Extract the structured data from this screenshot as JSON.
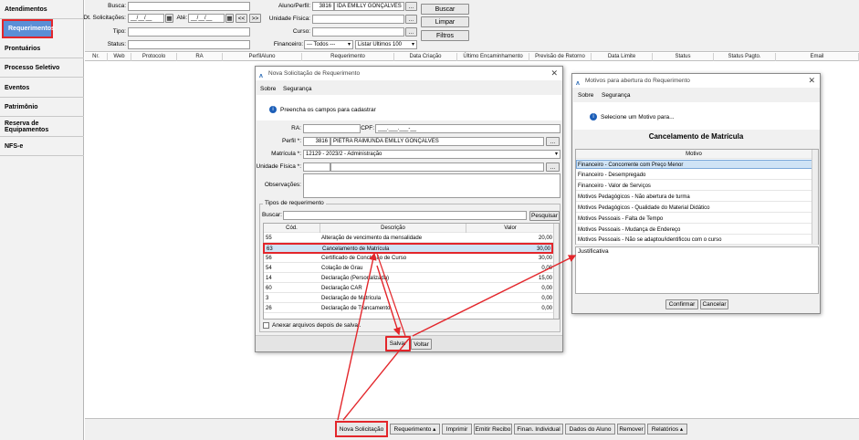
{
  "sidebar": {
    "items": [
      {
        "label": "Atendimentos"
      },
      {
        "label": "Requerimentos"
      },
      {
        "label": "Prontuários"
      },
      {
        "label": "Processo Seletivo"
      },
      {
        "label": "Eventos"
      },
      {
        "label": "Patrimônio"
      },
      {
        "label": "Reserva de Equipamentos"
      },
      {
        "label": "NFS-e"
      }
    ]
  },
  "header": {
    "busca_label": "Busca:",
    "dt_label": "Dt. Solicitações:",
    "dt_from": "__/__/__",
    "ate_label": "Até:",
    "dt_to": "__/__/__",
    "prev_label": "<<",
    "next_label": ">>",
    "tipo_label": "Tipo:",
    "status_label": "Status:",
    "aluno_label": "Aluno/Perfil:",
    "aluno_code": "3816",
    "aluno_name": "IDA EMILLY GONÇALVES",
    "unidade_label": "Unidade Física:",
    "curso_label": "Curso:",
    "financeiro_label": "Financeiro:",
    "financeiro_value": "--- Todos ---",
    "listar_value": "Listar Últimos 100",
    "buscar_btn": "Buscar",
    "limpar_btn": "Limpar",
    "filtros_btn": "Filtros",
    "ellipsis": "..."
  },
  "grid": {
    "columns": [
      "Nr.",
      "Web",
      "Protocolo",
      "RA",
      "PerfilAluno",
      "Requerimento",
      "Data Criação",
      "Último Encaminhamento",
      "Previsão de Retorno",
      "Data Limite",
      "Status",
      "Status Pagto.",
      "Email"
    ]
  },
  "bottom": {
    "buttons": [
      "Nova Solicitação",
      "Requerimento ▴",
      "Imprimir",
      "Emitir Recibo",
      "Finan. Individual",
      "Dados do Aluno",
      "Remover",
      "Relatórios ▴"
    ]
  },
  "dialog1": {
    "title": "Nova Solicitação de Requerimento",
    "menu_sobre": "Sobre",
    "menu_seguranca": "Segurança",
    "info": "Preencha os campos para cadastrar",
    "ra_label": "RA:",
    "cpf_label": "CPF:",
    "cpf_value": "___.___.___-__",
    "perfil_label": "Perfil *:",
    "perfil_code": "3816",
    "perfil_name": "PIETRA RAIMUNDA EMILLY GONÇALVES",
    "matricula_label": "Matrícula *:",
    "matricula_value": "12129 - 2023/2 - Administração",
    "unidade_label": "Unidade Física *:",
    "obs_label": "Observações:",
    "group_label": "Tipos de requerimento",
    "buscar_label": "Buscar:",
    "pesquisar_btn": "Pesquisar",
    "col_cod": "Cód.",
    "col_desc": "Descrição",
    "col_valor": "Valor",
    "rows": [
      {
        "cod": "55",
        "desc": "Alteração de vencimento da mensalidade",
        "valor": "20,00"
      },
      {
        "cod": "63",
        "desc": "Cancelamento de Matrícula",
        "valor": "30,00"
      },
      {
        "cod": "56",
        "desc": "Certificado de Conclusão de Curso",
        "valor": "30,00"
      },
      {
        "cod": "54",
        "desc": "Colação de Grau",
        "valor": "0,00"
      },
      {
        "cod": "14",
        "desc": "Declaração (Personalizada)",
        "valor": "15,00"
      },
      {
        "cod": "60",
        "desc": "Declaração CAR",
        "valor": "0,00"
      },
      {
        "cod": "3",
        "desc": "Declaração de Matrícula",
        "valor": "0,00"
      },
      {
        "cod": "26",
        "desc": "Declaração de Trancamento",
        "valor": "0,00"
      }
    ],
    "anexar_label": "Anexar arquivos depois de salvar.",
    "salvar_btn": "Salvar",
    "voltar_btn": "Voltar",
    "ellipsis": "..."
  },
  "dialog2": {
    "title": "Motivos para abertura do Requerimento",
    "menu_sobre": "Sobre",
    "menu_seguranca": "Segurança",
    "info": "Selecione um Motivo para...",
    "heading": "Cancelamento de Matrícula",
    "col_motivo": "Motivo",
    "rows": [
      "Financeiro - Concorrente com Preço Menor",
      "Financeiro - Desempregado",
      "Financeiro - Valor de Serviços",
      "Motivos Pedagógicos - Não abertura de turma",
      "Motivos Pedagógicos - Qualidade do Material Didático",
      "Motivos Pessoais - Falta de Tempo",
      "Motivos Pessoais - Mudança de Endereço",
      "Motivos Pessoais - Não se adaptou/identificou com o curso"
    ],
    "justificativa_label": "Justificativa",
    "confirmar_btn": "Confirmar",
    "cancelar_btn": "Cancelar"
  },
  "colors": {
    "accent": "#5b8fd6",
    "highlight_red": "#e3262b",
    "selected_row": "#cfe3f5"
  }
}
